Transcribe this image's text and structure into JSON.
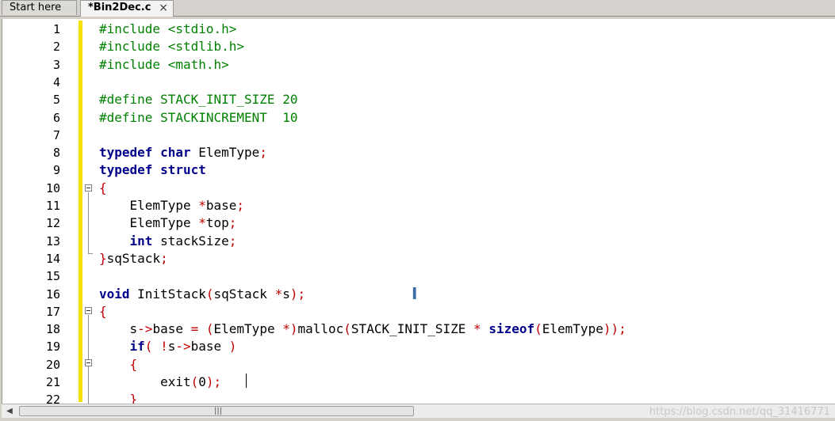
{
  "tabs": [
    {
      "label": "Start here",
      "active": false
    },
    {
      "label": "*Bin2Dec.c",
      "active": true
    }
  ],
  "tab_close_glyph": "×",
  "editor": {
    "lines": [
      {
        "n": "1",
        "tokens": [
          [
            "pp",
            "#include <stdio.h>"
          ]
        ]
      },
      {
        "n": "2",
        "tokens": [
          [
            "pp",
            "#include <stdlib.h>"
          ]
        ]
      },
      {
        "n": "3",
        "tokens": [
          [
            "pp",
            "#include <math.h>"
          ]
        ]
      },
      {
        "n": "4",
        "tokens": []
      },
      {
        "n": "5",
        "tokens": [
          [
            "pp",
            "#define STACK_INIT_SIZE 20"
          ]
        ]
      },
      {
        "n": "6",
        "tokens": [
          [
            "pp",
            "#define STACKINCREMENT  10"
          ]
        ]
      },
      {
        "n": "7",
        "tokens": []
      },
      {
        "n": "8",
        "tokens": [
          [
            "kw",
            "typedef"
          ],
          [
            "",
            ""
          ],
          [
            "",
            ""
          ],
          [
            "kw",
            " char"
          ],
          [
            "",
            " ElemType"
          ],
          [
            "op",
            ";"
          ]
        ]
      },
      {
        "n": "9",
        "tokens": [
          [
            "kw",
            "typedef struct"
          ]
        ]
      },
      {
        "n": "10",
        "tokens": [
          [
            "op",
            "{"
          ]
        ]
      },
      {
        "n": "11",
        "tokens": [
          [
            "",
            "    ElemType "
          ],
          [
            "op",
            "*"
          ],
          [
            "",
            "base"
          ],
          [
            "op",
            ";"
          ]
        ]
      },
      {
        "n": "12",
        "tokens": [
          [
            "",
            "    ElemType "
          ],
          [
            "op",
            "*"
          ],
          [
            "",
            "top"
          ],
          [
            "op",
            ";"
          ]
        ]
      },
      {
        "n": "13",
        "tokens": [
          [
            "kw",
            "    int"
          ],
          [
            "",
            " stackSize"
          ],
          [
            "op",
            ";"
          ]
        ]
      },
      {
        "n": "14",
        "tokens": [
          [
            "op",
            "}"
          ],
          [
            "",
            "sqStack"
          ],
          [
            "op",
            ";"
          ]
        ]
      },
      {
        "n": "15",
        "tokens": []
      },
      {
        "n": "16",
        "tokens": [
          [
            "kw",
            "void"
          ],
          [
            "",
            " InitStack"
          ],
          [
            "op",
            "("
          ],
          [
            "",
            "sqStack "
          ],
          [
            "op",
            "*"
          ],
          [
            "",
            "s"
          ],
          [
            "op",
            ");"
          ]
        ]
      },
      {
        "n": "17",
        "tokens": [
          [
            "op",
            "{"
          ]
        ]
      },
      {
        "n": "18",
        "tokens": [
          [
            "",
            "    s"
          ],
          [
            "op",
            "->"
          ],
          [
            "",
            "base "
          ],
          [
            "op",
            "="
          ],
          [
            "",
            ""
          ],
          [
            "op",
            " ("
          ],
          [
            "",
            "ElemType "
          ],
          [
            "op",
            "*)"
          ],
          [
            "",
            "malloc"
          ],
          [
            "op",
            "("
          ],
          [
            "",
            "STACK_INIT_SIZE "
          ],
          [
            "op",
            "*"
          ],
          [
            "kw",
            " sizeof"
          ],
          [
            "op",
            "("
          ],
          [
            "",
            "ElemType"
          ],
          [
            "op",
            "));"
          ]
        ]
      },
      {
        "n": "19",
        "tokens": [
          [
            "kw",
            "    if"
          ],
          [
            "op",
            "("
          ],
          [
            "",
            " "
          ],
          [
            "op",
            "!"
          ],
          [
            "",
            "s"
          ],
          [
            "op",
            "->"
          ],
          [
            "",
            "base "
          ],
          [
            "op",
            ")"
          ]
        ]
      },
      {
        "n": "20",
        "tokens": [
          [
            "op",
            "    {"
          ]
        ]
      },
      {
        "n": "21",
        "tokens": [
          [
            "",
            "        exit"
          ],
          [
            "op",
            "("
          ],
          [
            "",
            "0"
          ],
          [
            "op",
            ");"
          ]
        ]
      },
      {
        "n": "22",
        "tokens": [
          [
            "op",
            "    }"
          ]
        ]
      }
    ]
  },
  "scrollbar": {
    "left_arrow": "◀",
    "grip": "|||"
  },
  "watermark": "https://blog.csdn.net/qq_31416771"
}
